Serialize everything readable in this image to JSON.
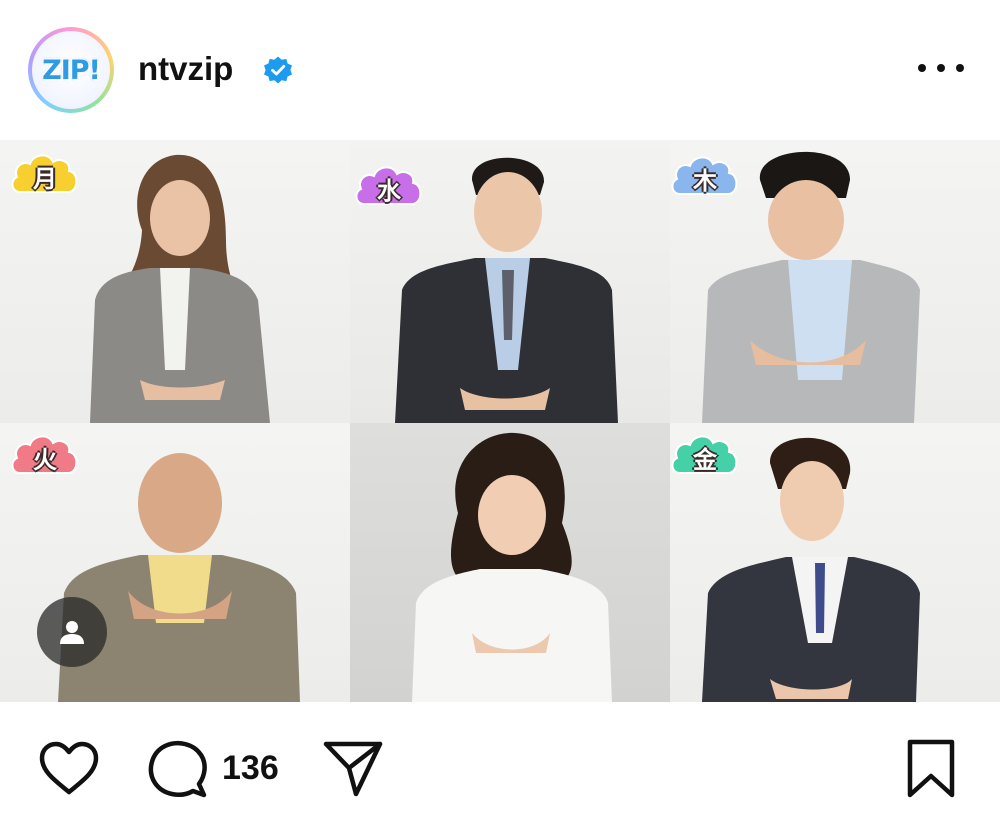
{
  "header": {
    "avatar_logo": "ZIP!",
    "username": "ntvzip",
    "verified_icon": "verified-badge-icon",
    "more_icon": "more-options-icon"
  },
  "post": {
    "grid": [
      {
        "day": "月",
        "badge_color": "#f7cf2e",
        "suit": "#8c8a86",
        "shirt": "#f2f2ee"
      },
      {
        "day": "水",
        "badge_color": "#c86ee8",
        "suit": "#2f3035",
        "shirt": "#b9cde6"
      },
      {
        "day": "木",
        "badge_color": "#8ab6ee",
        "suit": "#b6b8ba",
        "shirt": "#cfdff2"
      },
      {
        "day": "火",
        "badge_color": "#f07a86",
        "suit": "#8c8470",
        "shirt": "#f0dc8a"
      },
      {
        "day": "",
        "badge_color": "",
        "suit": "#f6f6f4",
        "shirt": "#ffffff"
      },
      {
        "day": "金",
        "badge_color": "#45d0a8",
        "suit": "#33363f",
        "shirt": "#f4f4f4"
      }
    ],
    "tag_icon": "user-tag-icon"
  },
  "actions": {
    "like_icon": "heart-icon",
    "comment_icon": "comment-icon",
    "comment_count": "136",
    "share_icon": "send-icon",
    "save_icon": "bookmark-icon"
  }
}
